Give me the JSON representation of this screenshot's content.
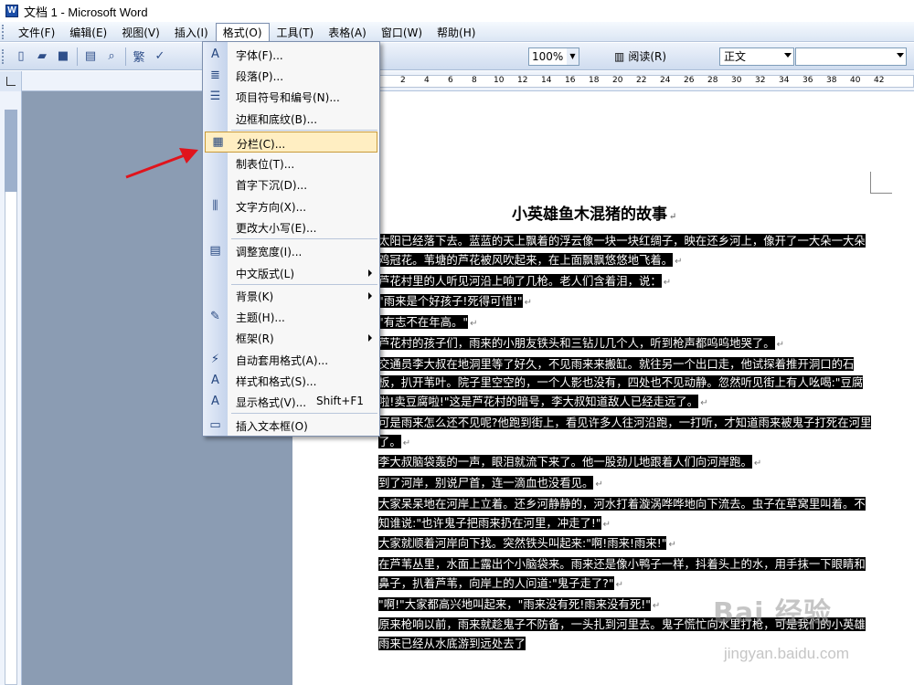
{
  "window": {
    "title": "文档 1 - Microsoft Word"
  },
  "menubar": {
    "items": [
      "文件(F)",
      "编辑(E)",
      "视图(V)",
      "插入(I)",
      "格式(O)",
      "工具(T)",
      "表格(A)",
      "窗口(W)",
      "帮助(H)"
    ]
  },
  "toolbar": {
    "zoom": "100%",
    "reading_label": "阅读(R)",
    "style": "正文",
    "font": ""
  },
  "ruler": {
    "ticks": [
      "2",
      "4",
      "6",
      "8",
      "10",
      "12",
      "14",
      "16",
      "18",
      "20",
      "22",
      "24",
      "26",
      "28",
      "30",
      "32",
      "34",
      "36",
      "38",
      "40",
      "42"
    ]
  },
  "format_menu": {
    "items": [
      {
        "label": "字体(F)...",
        "icon": "font-a-icon"
      },
      {
        "label": "段落(P)...",
        "icon": "paragraph-icon"
      },
      {
        "label": "项目符号和编号(N)...",
        "icon": "bullets-icon"
      },
      {
        "label": "边框和底纹(B)...",
        "icon": ""
      },
      {
        "label": "分栏(C)...",
        "icon": "columns-icon"
      },
      {
        "label": "制表位(T)...",
        "icon": ""
      },
      {
        "label": "首字下沉(D)...",
        "icon": ""
      },
      {
        "label": "文字方向(X)...",
        "icon": "text-direction-icon"
      },
      {
        "label": "更改大小写(E)...",
        "icon": ""
      },
      {
        "label": "调整宽度(I)...",
        "icon": "fit-width-icon"
      },
      {
        "label": "中文版式(L)",
        "icon": ""
      },
      {
        "label": "背景(K)",
        "icon": ""
      },
      {
        "label": "主题(H)...",
        "icon": "theme-icon"
      },
      {
        "label": "框架(R)",
        "icon": ""
      },
      {
        "label": "自动套用格式(A)...",
        "icon": "autoformat-icon"
      },
      {
        "label": "样式和格式(S)...",
        "icon": "styles-icon"
      },
      {
        "label": "显示格式(V)...",
        "icon": "reveal-format-icon"
      },
      {
        "label": "插入文本框(O)",
        "icon": "textbox-icon"
      }
    ],
    "shortcut_reveal": "Shift+F1"
  },
  "document": {
    "title": "小英雄鱼木混猪的故事",
    "paragraphs": [
      "太阳已经落下去。蓝蓝的天上飘着的浮云像一块一块红绸子，映在还乡河上，像开了一大朵一大朵鸡冠花。苇塘的芦花被风吹起来，在上面飘飘悠悠地飞着。",
      "芦花村里的人听见河沿上响了几枪。老人们含着泪，说：",
      "\"雨来是个好孩子!死得可惜!\"",
      "\"有志不在年高。\"",
      "芦花村的孩子们，雨来的小朋友铁头和三钻儿几个人，听到枪声都呜呜地哭了。",
      "交通员李大叔在地洞里等了好久，不见雨来来搬缸。就往另一个出口走，他试探着推开洞口的石板，扒开苇叶。院子里空空的，一个人影也没有，四处也不见动静。忽然听见街上有人吆喝:\"豆腐啦!卖豆腐啦!\"这是芦花村的暗号，李大叔知道敌人已经走远了。",
      "可是雨来怎么还不见呢?他跑到街上，看见许多人往河沿跑，一打听，才知道雨来被鬼子打死在河里了。",
      "李大叔脑袋轰的一声，眼泪就流下来了。他一股劲儿地跟着人们向河岸跑。",
      "到了河岸，别说尸首，连一滴血也没看见。",
      "大家呆呆地在河岸上立着。还乡河静静的，河水打着漩涡哗哗地向下流去。虫子在草窝里叫着。不知谁说:\"也许鬼子把雨来扔在河里，冲走了!\"",
      "大家就顺着河岸向下找。突然铁头叫起来:\"啊!雨来!雨来!\"",
      "在芦苇丛里，水面上露出个小脑袋来。雨来还是像小鸭子一样，抖着头上的水，用手抹一下眼睛和鼻子，扒着芦苇，向岸上的人问道:\"鬼子走了?\"",
      "\"啊!\"大家都高兴地叫起来，\"雨来没有死!雨来没有死!\"",
      "原来枪响以前，雨来就趁鬼子不防备，一头扎到河里去。鬼子慌忙向水里打枪，可是我们的小英雄雨来已经从水底游到远处去了"
    ]
  },
  "watermark": {
    "logo": "Bai 经验",
    "url": "jingyan.baidu.com"
  }
}
